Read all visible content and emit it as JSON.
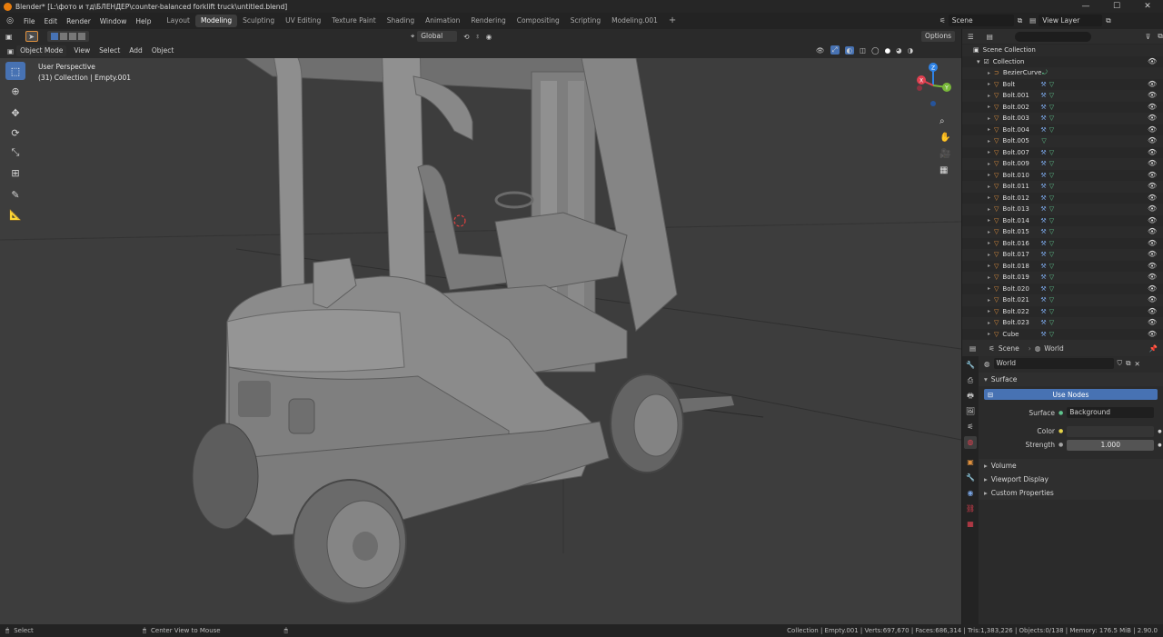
{
  "titlebar": {
    "title": "Blender* [L:\\фото и тд\\БЛЕНДЕР\\counter-balanced forklift truck\\untitled.blend]"
  },
  "window_controls": {
    "minimize": "—",
    "maximize": "☐",
    "close": "✕"
  },
  "menubar": {
    "items": [
      "File",
      "Edit",
      "Render",
      "Window",
      "Help"
    ],
    "workspaces": [
      "Layout",
      "Modeling",
      "Sculpting",
      "UV Editing",
      "Texture Paint",
      "Shading",
      "Animation",
      "Rendering",
      "Compositing",
      "Scripting",
      "Modeling.001"
    ],
    "active_workspace": "Modeling",
    "add_tab": "+",
    "scene_label": "Scene",
    "view_layer_label": "View Layer"
  },
  "tool_header": {
    "orientation": "Global",
    "options": "Options"
  },
  "view_header": {
    "mode": "Object Mode",
    "menus": [
      "View",
      "Select",
      "Add",
      "Object"
    ]
  },
  "viewport": {
    "perspective": "User Perspective",
    "collection_info": "(31) Collection | Empty.001"
  },
  "toolbar": {
    "tools": [
      "select-box-icon",
      "cursor-icon",
      "move-icon",
      "rotate-icon",
      "scale-icon",
      "transform-icon",
      "annotate-icon",
      "measure-icon"
    ]
  },
  "gizmo": {
    "x": "X",
    "y": "Y",
    "z": "Z"
  },
  "outliner": {
    "search_placeholder": "",
    "scene_collection": "Scene Collection",
    "collection": "Collection",
    "items": [
      "BezierCurve",
      "Bolt",
      "Bolt.001",
      "Bolt.002",
      "Bolt.003",
      "Bolt.004",
      "Bolt.005",
      "Bolt.007",
      "Bolt.009",
      "Bolt.010",
      "Bolt.011",
      "Bolt.012",
      "Bolt.013",
      "Bolt.014",
      "Bolt.015",
      "Bolt.016",
      "Bolt.017",
      "Bolt.018",
      "Bolt.019",
      "Bolt.020",
      "Bolt.021",
      "Bolt.022",
      "Bolt.023",
      "Cube"
    ]
  },
  "properties": {
    "tab_scene": "Scene",
    "tab_world": "World",
    "world_name": "World",
    "surface_title": "Surface",
    "use_nodes": "Use Nodes",
    "surface_label": "Surface",
    "surface_value": "Background",
    "color_label": "Color",
    "strength_label": "Strength",
    "strength_value": "1.000",
    "sections": [
      "Volume",
      "Viewport Display",
      "Custom Properties"
    ]
  },
  "statusbar": {
    "select": "Select",
    "center_view": "Center View to Mouse",
    "stats": "Collection | Empty.001 | Verts:697,670 | Faces:686,314 | Tris:1,383,226 | Objects:0/138 | Memory: 176.5 MiB | 2.90.0"
  },
  "colors": {
    "accent": "#4772b3",
    "object_orange": "#e0913e",
    "mesh_green": "#5fc48d",
    "modifier_blue": "#7aa6e6",
    "viewport_bg": "#3d3d3d",
    "model_grey": "#8a8a8a"
  }
}
